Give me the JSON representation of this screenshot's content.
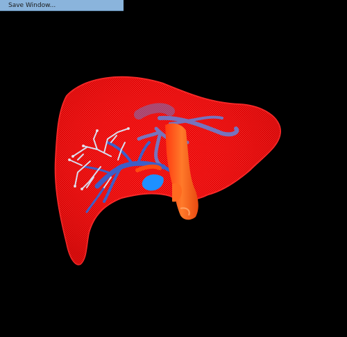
{
  "toolbar": {
    "save_window_label": "Save Window..."
  },
  "colors": {
    "background": "#000000",
    "button": "#8ab4dc",
    "liver": "#ff1a1a",
    "portal_vein": "#3d5fc8",
    "hepatic_vein": "#6a7fd0",
    "bile_duct": "#cfd8f0",
    "vena_cava": "#ff5a1a",
    "gallbladder": "#1e90ff"
  }
}
